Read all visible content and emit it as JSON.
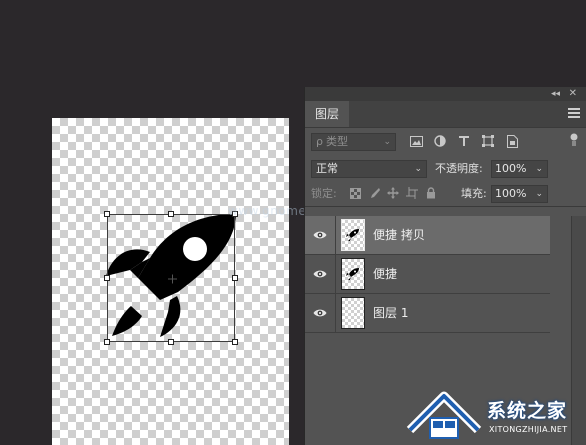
{
  "canvas": {
    "watermark_text": "www.gnome.NET"
  },
  "panel": {
    "tab_label": "图层",
    "filter": {
      "search_glyph": "ρ",
      "placeholder": "类型"
    },
    "blend_mode": "正常",
    "opacity_label": "不透明度:",
    "opacity_value": "100%",
    "lock_label": "锁定:",
    "fill_label": "填充:",
    "fill_value": "100%",
    "layers": [
      {
        "name": "便捷 拷贝",
        "selected": true,
        "visible": true
      },
      {
        "name": "便捷",
        "selected": false,
        "visible": true
      },
      {
        "name": "图层 1",
        "selected": false,
        "visible": true
      }
    ]
  },
  "logo": {
    "name": "系统之家",
    "url": "XITONGZHIJIA.NET"
  },
  "colors": {
    "canvas_bg": "#2b282b",
    "panel_bg": "#535353",
    "selected_row": "#6b6b6b"
  }
}
